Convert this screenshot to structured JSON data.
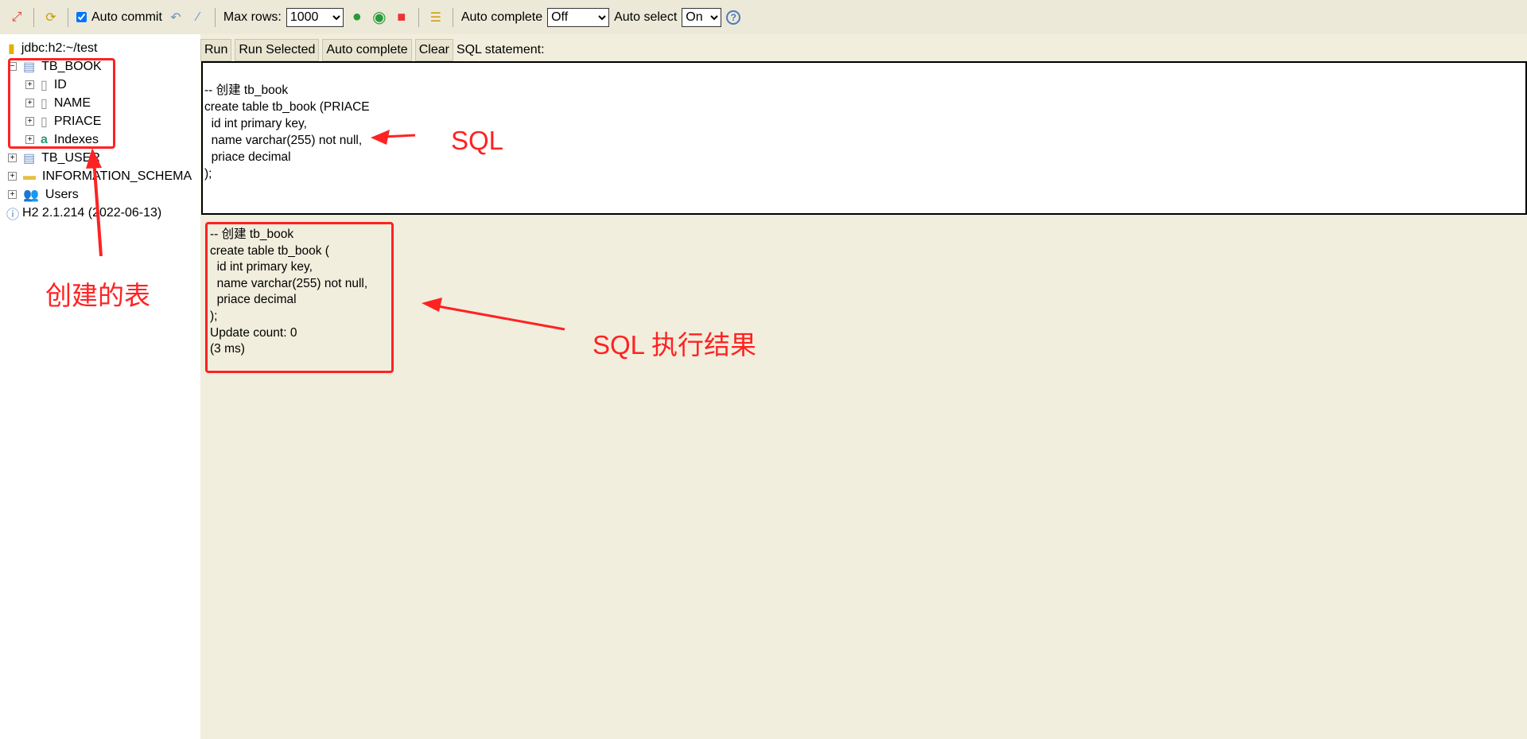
{
  "toolbar": {
    "auto_commit_label": "Auto commit",
    "auto_commit_checked": true,
    "max_rows_label": "Max rows:",
    "max_rows_value": "1000",
    "auto_complete_label": "Auto complete",
    "auto_complete_value": "Off",
    "auto_select_label": "Auto select",
    "auto_select_value": "On",
    "help": "?"
  },
  "tree": {
    "connection": "jdbc:h2:~/test",
    "tb_book": "TB_BOOK",
    "columns": [
      "ID",
      "NAME",
      "PRIACE"
    ],
    "indexes": "Indexes",
    "tb_user": "TB_USER",
    "info_schema": "INFORMATION_SCHEMA",
    "users": "Users",
    "version": "H2 2.1.214 (2022-06-13)"
  },
  "buttons": {
    "run": "Run",
    "run_selected": "Run Selected",
    "auto_complete": "Auto complete",
    "clear": "Clear",
    "sql_statement_label": "SQL statement:"
  },
  "sql_text": "-- 创建 tb_book\ncreate table tb_book (PRIACE\n  id int primary key,\n  name varchar(255) not null,\n  priace decimal\n);",
  "result_text": "-- 创建 tb_book\ncreate table tb_book (\n  id int primary key,\n  name varchar(255) not null,\n  priace decimal\n);\nUpdate count: 0\n(3 ms)",
  "annotations": {
    "sql": "SQL",
    "table": "创建的表",
    "result": "SQL 执行结果"
  },
  "colors": {
    "annotation": "#ff2222",
    "background": "#f1eedd",
    "toolbar": "#ece9d8"
  }
}
